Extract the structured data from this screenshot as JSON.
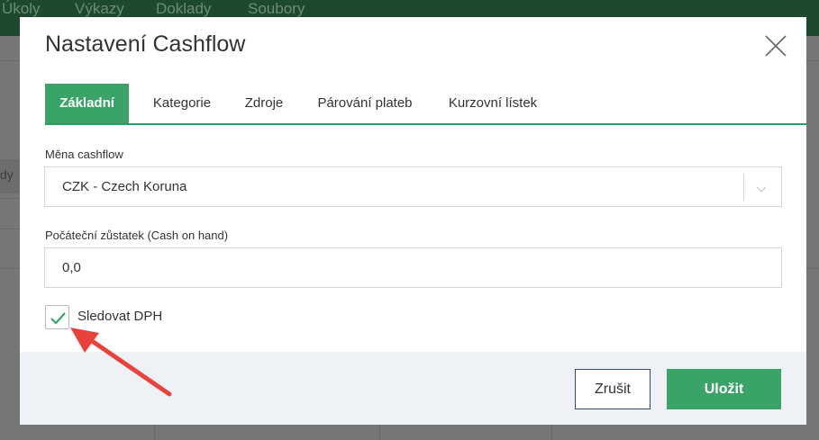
{
  "app": {
    "nav": [
      "Úkoly",
      "Výkazy",
      "Doklady",
      "Soubory"
    ],
    "side_text": "dy"
  },
  "modal": {
    "title": "Nastavení Cashflow",
    "tabs": [
      {
        "label": "Základní",
        "active": true
      },
      {
        "label": "Kategorie",
        "active": false
      },
      {
        "label": "Zdroje",
        "active": false
      },
      {
        "label": "Párování plateb",
        "active": false
      },
      {
        "label": "Kurzovní lístek",
        "active": false
      }
    ],
    "currency": {
      "label": "Měna cashflow",
      "value": "CZK - Czech Koruna"
    },
    "cash_on_hand": {
      "label": "Počáteční zůstatek (Cash on hand)",
      "value": "0,0"
    },
    "track_vat": {
      "label": "Sledovat DPH",
      "checked": true
    },
    "buttons": {
      "cancel": "Zrušit",
      "save": "Uložit"
    }
  },
  "colors": {
    "accent": "#3aa468",
    "annotation_arrow": "#e8423b"
  }
}
